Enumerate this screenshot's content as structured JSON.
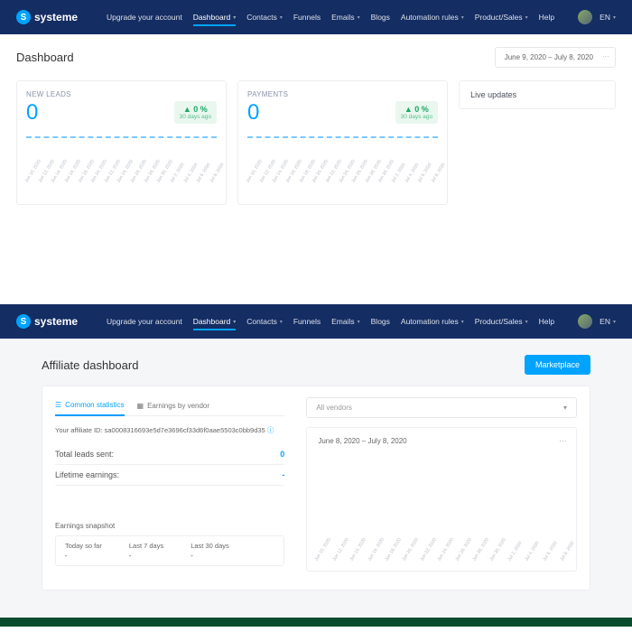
{
  "brand": "systeme",
  "nav": {
    "upgrade": "Upgrade your account",
    "items": [
      "Dashboard",
      "Contacts",
      "Funnels",
      "Emails",
      "Blogs",
      "Automation rules",
      "Product/Sales"
    ],
    "help": "Help",
    "lang": "EN"
  },
  "dashboard": {
    "title": "Dashboard",
    "date_range": "June 9, 2020  –  July 8, 2020",
    "cards": [
      {
        "label": "NEW LEADS",
        "value": "0",
        "pct": "▲ 0 %",
        "sub": "30 days ago"
      },
      {
        "label": "PAYMENTS",
        "value": "0",
        "pct": "▲ 0 %",
        "sub": "30 days ago"
      }
    ],
    "live": "Live updates",
    "xdates": [
      "Jun 10, 2020",
      "Jun 12, 2020",
      "Jun 14, 2020",
      "Jun 16, 2020",
      "Jun 18, 2020",
      "Jun 20, 2020",
      "Jun 22, 2020",
      "Jun 24, 2020",
      "Jun 26, 2020",
      "Jun 28, 2020",
      "Jun 30, 2020",
      "Jul 2, 2020",
      "Jul 4, 2020",
      "Jul 6, 2020",
      "Jul 8, 2020"
    ]
  },
  "affiliate": {
    "title": "Affiliate dashboard",
    "marketplace": "Marketplace",
    "tabs": {
      "common": "Common statistics",
      "earnings": "Earnings by vendor"
    },
    "aff_id_label": "Your affiliate ID:",
    "aff_id": "sa0008316693e5d7e3696cf33d6f0aae5503c0bb9d35",
    "stats": {
      "total_leads_k": "Total leads sent:",
      "total_leads_v": "0",
      "lifetime_k": "Lifetime earnings:",
      "lifetime_v": "-"
    },
    "snapshot": {
      "title": "Earnings snapshot",
      "cols": [
        {
          "k": "Today so far",
          "v": "-"
        },
        {
          "k": "Last 7 days",
          "v": "-"
        },
        {
          "k": "Last 30 days",
          "v": "-"
        }
      ]
    },
    "vendor_sel": "All vendors",
    "date_range": "June 8, 2020  –  July 8, 2020",
    "xdates": [
      "Jun 10, 2020",
      "Jun 12, 2020",
      "Jun 14, 2020",
      "Jun 16, 2020",
      "Jun 18, 2020",
      "Jun 20, 2020",
      "Jun 22, 2020",
      "Jun 24, 2020",
      "Jun 26, 2020",
      "Jun 28, 2020",
      "Jun 30, 2020",
      "Jul 2, 2020",
      "Jul 4, 2020",
      "Jul 6, 2020",
      "Jul 8, 2020"
    ]
  },
  "chart_data": [
    {
      "type": "line",
      "title": "NEW LEADS",
      "categories": [
        "Jun 10",
        "Jun 12",
        "Jun 14",
        "Jun 16",
        "Jun 18",
        "Jun 20",
        "Jun 22",
        "Jun 24",
        "Jun 26",
        "Jun 28",
        "Jun 30",
        "Jul 2",
        "Jul 4",
        "Jul 6",
        "Jul 8"
      ],
      "values": [
        0,
        0,
        0,
        0,
        0,
        0,
        0,
        0,
        0,
        0,
        0,
        0,
        0,
        0,
        0
      ],
      "ylim": [
        0,
        1
      ]
    },
    {
      "type": "line",
      "title": "PAYMENTS",
      "categories": [
        "Jun 10",
        "Jun 12",
        "Jun 14",
        "Jun 16",
        "Jun 18",
        "Jun 20",
        "Jun 22",
        "Jun 24",
        "Jun 26",
        "Jun 28",
        "Jun 30",
        "Jul 2",
        "Jul 4",
        "Jul 6",
        "Jul 8"
      ],
      "values": [
        0,
        0,
        0,
        0,
        0,
        0,
        0,
        0,
        0,
        0,
        0,
        0,
        0,
        0,
        0
      ],
      "ylim": [
        0,
        1
      ]
    }
  ]
}
